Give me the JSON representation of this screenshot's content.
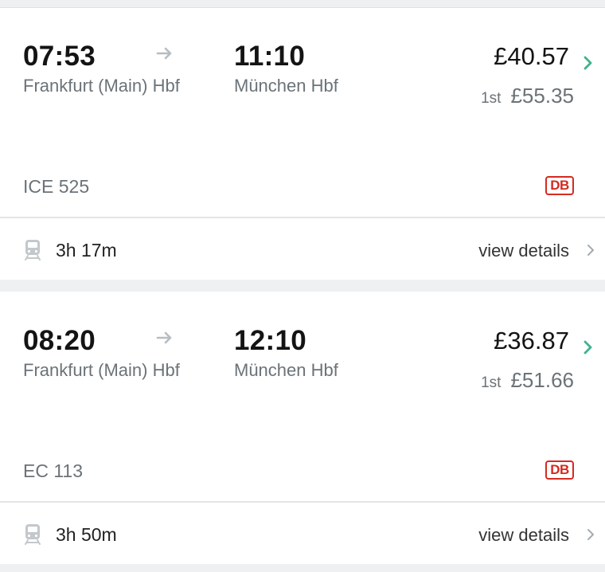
{
  "journeys": [
    {
      "departure_time": "07:53",
      "departure_station": "Frankfurt (Main) Hbf",
      "arrival_time": "11:10",
      "arrival_station": "München Hbf",
      "price": "£40.57",
      "first_class_label": "1st",
      "first_class_price": "£55.35",
      "train": "ICE 525",
      "operator_logo": "DB",
      "duration": "3h 17m",
      "details_label": "view details"
    },
    {
      "departure_time": "08:20",
      "departure_station": "Frankfurt (Main) Hbf",
      "arrival_time": "12:10",
      "arrival_station": "München Hbf",
      "price": "£36.87",
      "first_class_label": "1st",
      "first_class_price": "£51.66",
      "train": "EC 113",
      "operator_logo": "DB",
      "duration": "3h 50m",
      "details_label": "view details"
    }
  ],
  "icons": {
    "arrow": "arrow-right-icon",
    "chevron_green": "chevron-right-icon",
    "chevron_grey": "chevron-right-icon",
    "train": "train-icon"
  },
  "colors": {
    "accent_green": "#3fb28f",
    "db_red": "#d62a20",
    "muted_text": "#6b7378",
    "background": "#eef0f2"
  }
}
